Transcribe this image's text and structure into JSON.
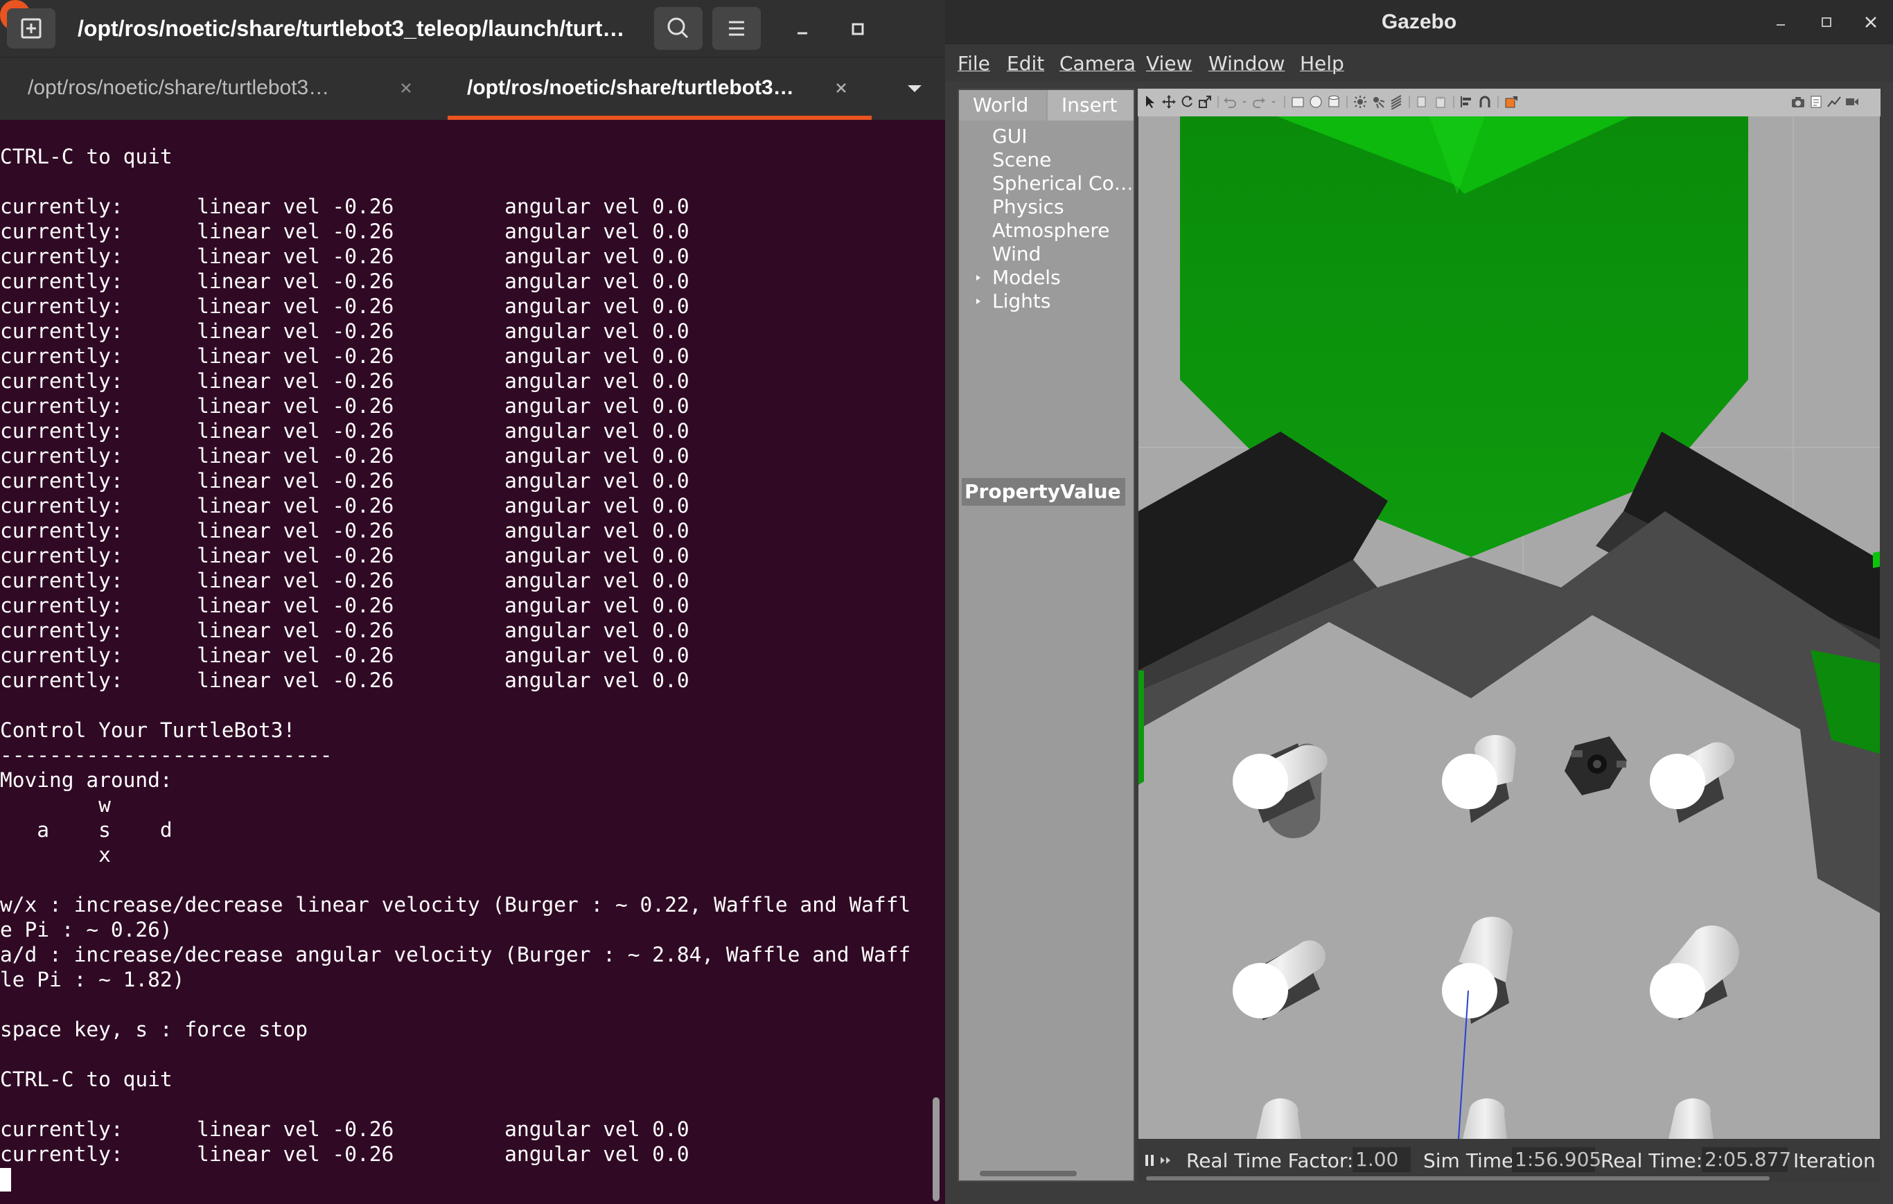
{
  "terminal": {
    "title": "/opt/ros/noetic/share/turtlebot3_teleop/launch/turt…",
    "tabs": [
      {
        "label": "/opt/ros/noetic/share/turtlebot3…"
      },
      {
        "label": "/opt/ros/noetic/share/turtlebot3…"
      }
    ],
    "output_lines": [
      "CTRL-C to quit",
      "",
      "currently:\tlinear vel -0.26\t angular vel 0.0",
      "currently:\tlinear vel -0.26\t angular vel 0.0",
      "currently:\tlinear vel -0.26\t angular vel 0.0",
      "currently:\tlinear vel -0.26\t angular vel 0.0",
      "currently:\tlinear vel -0.26\t angular vel 0.0",
      "currently:\tlinear vel -0.26\t angular vel 0.0",
      "currently:\tlinear vel -0.26\t angular vel 0.0",
      "currently:\tlinear vel -0.26\t angular vel 0.0",
      "currently:\tlinear vel -0.26\t angular vel 0.0",
      "currently:\tlinear vel -0.26\t angular vel 0.0",
      "currently:\tlinear vel -0.26\t angular vel 0.0",
      "currently:\tlinear vel -0.26\t angular vel 0.0",
      "currently:\tlinear vel -0.26\t angular vel 0.0",
      "currently:\tlinear vel -0.26\t angular vel 0.0",
      "currently:\tlinear vel -0.26\t angular vel 0.0",
      "currently:\tlinear vel -0.26\t angular vel 0.0",
      "currently:\tlinear vel -0.26\t angular vel 0.0",
      "currently:\tlinear vel -0.26\t angular vel 0.0",
      "currently:\tlinear vel -0.26\t angular vel 0.0",
      "currently:\tlinear vel -0.26\t angular vel 0.0",
      "",
      "Control Your TurtleBot3!",
      "---------------------------",
      "Moving around:",
      "        w",
      "   a    s    d",
      "        x",
      "",
      "w/x : increase/decrease linear velocity (Burger : ~ 0.22, Waffle and Waffl",
      "e Pi : ~ 0.26)",
      "a/d : increase/decrease angular velocity (Burger : ~ 2.84, Waffle and Waff",
      "le Pi : ~ 1.82)",
      "",
      "space key, s : force stop",
      "",
      "CTRL-C to quit",
      "",
      "currently:\tlinear vel -0.26\t angular vel 0.0",
      "currently:\tlinear vel -0.26\t angular vel 0.0"
    ]
  },
  "gazebo": {
    "window_title": "Gazebo",
    "menu": [
      "File",
      "Edit",
      "Camera",
      "View",
      "Window",
      "Help"
    ],
    "left_tabs": {
      "world": "World",
      "insert": "Insert"
    },
    "world_tree": [
      {
        "label": "GUI",
        "expandable": false
      },
      {
        "label": "Scene",
        "expandable": false
      },
      {
        "label": "Spherical Co…",
        "expandable": false
      },
      {
        "label": "Physics",
        "expandable": false
      },
      {
        "label": "Atmosphere",
        "expandable": false
      },
      {
        "label": "Wind",
        "expandable": false
      },
      {
        "label": "Models",
        "expandable": true
      },
      {
        "label": "Lights",
        "expandable": true
      }
    ],
    "property_header": "PropertyValue",
    "status": {
      "real_time_factor_label": "Real Time Factor:",
      "real_time_factor": "1.00",
      "sim_time_label": "Sim Time:",
      "sim_time": "1:56.905",
      "real_time_label": "Real Time:",
      "real_time": "2:05.877",
      "iterations_label": "Iteration"
    },
    "colors": {
      "ground": "#a8a8a8",
      "green_block": "#0e9a0e",
      "wall_dark": "#1c1c1c",
      "cylinder": "#ffffff"
    }
  }
}
